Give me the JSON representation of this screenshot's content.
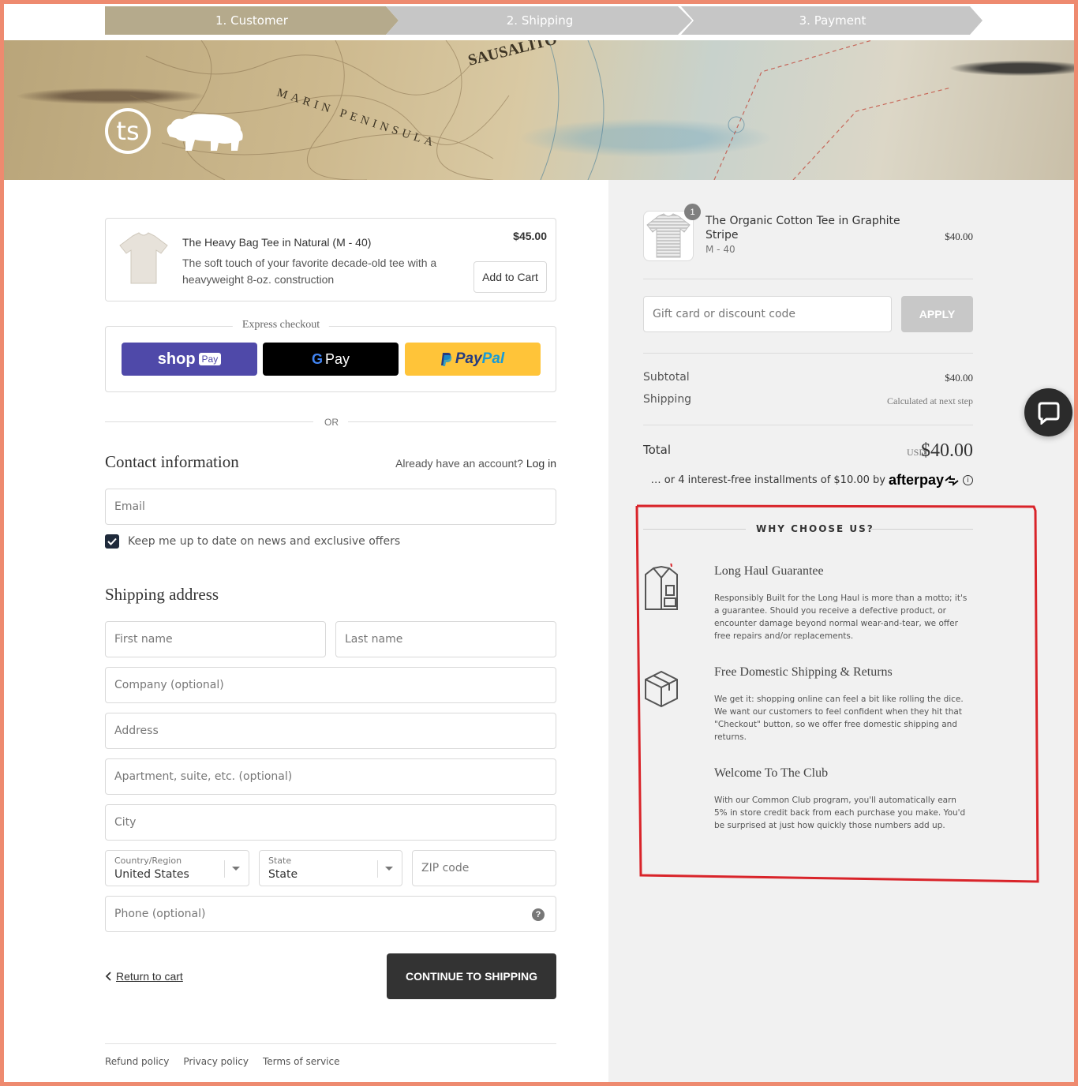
{
  "steps": [
    "1. Customer",
    "2. Shipping",
    "3. Payment"
  ],
  "colors": {
    "step_active": "#b5aa8c",
    "step_inactive": "#c6c6c6",
    "accent_red": "#d9242a",
    "frame": "#ee8a6f"
  },
  "upsell": {
    "name": "The Heavy Bag Tee in Natural (M - 40)",
    "description": "The soft touch of your favorite decade-old tee with a heavyweight 8-oz. construction",
    "price": "$45.00",
    "add_to_cart": "Add to Cart"
  },
  "express": {
    "title": "Express checkout",
    "shop_pay": "shop",
    "shop_pay_tag": "Pay",
    "gpay": "Pay",
    "gpay_g": "G",
    "paypal_pay": "Pay",
    "paypal_pal": "Pal"
  },
  "or_text": "OR",
  "contact": {
    "title": "Contact information",
    "already": "Already have an account?",
    "login": "Log in",
    "email_placeholder": "Email",
    "newsletter_label": "Keep me up to date on news and exclusive offers",
    "newsletter_checked": true
  },
  "shipping": {
    "title": "Shipping address",
    "first_name": "First name",
    "last_name": "Last name",
    "company": "Company (optional)",
    "address": "Address",
    "apartment": "Apartment, suite, etc. (optional)",
    "city": "City",
    "country_label": "Country/Region",
    "country_value": "United States",
    "state_label": "State",
    "state_value": "State",
    "zip": "ZIP code",
    "phone": "Phone (optional)"
  },
  "actions": {
    "return": "Return to cart",
    "continue": "CONTINUE TO SHIPPING"
  },
  "footer": [
    "Refund policy",
    "Privacy policy",
    "Terms of service"
  ],
  "cart": {
    "quantity": "1",
    "name": "The Organic Cotton Tee in Graphite Stripe",
    "variant": "M - 40",
    "price": "$40.00"
  },
  "discount": {
    "placeholder": "Gift card or discount code",
    "apply": "APPLY"
  },
  "summary": {
    "subtotal_label": "Subtotal",
    "subtotal_value": "$40.00",
    "shipping_label": "Shipping",
    "shipping_value": "Calculated at next step",
    "total_label": "Total",
    "total_currency": "USD",
    "total_value": "$40.00",
    "afterpay_text": "… or 4 interest-free installments of $10.00 by",
    "afterpay_brand": "afterpay"
  },
  "why": {
    "title": "WHY CHOOSE US?",
    "features": [
      {
        "title": "Long Haul Guarantee",
        "desc": "Responsibly Built for the Long Haul is more than a motto; it's a guarantee. Should you receive a defective product, or encounter damage beyond normal wear-and-tear, we offer free repairs and/or replacements.",
        "icon": "shirt-icon"
      },
      {
        "title": "Free Domestic Shipping & Returns",
        "desc": "We get it: shopping online can feel a bit like rolling the dice. We want our customers to feel confident when they hit that \"Checkout\" button, so we offer free domestic shipping and returns.",
        "icon": "box-icon"
      },
      {
        "title": "Welcome To The Club",
        "desc": "With our Common Club program, you'll automatically earn 5% in store credit back from each purchase you make. You'd be surprised at just how quickly those numbers add up.",
        "icon": ""
      }
    ]
  },
  "banner_text": {
    "sausalito": "SAUSALITO",
    "marin": "MARIN PENINSULA"
  },
  "logo_text": "ts"
}
